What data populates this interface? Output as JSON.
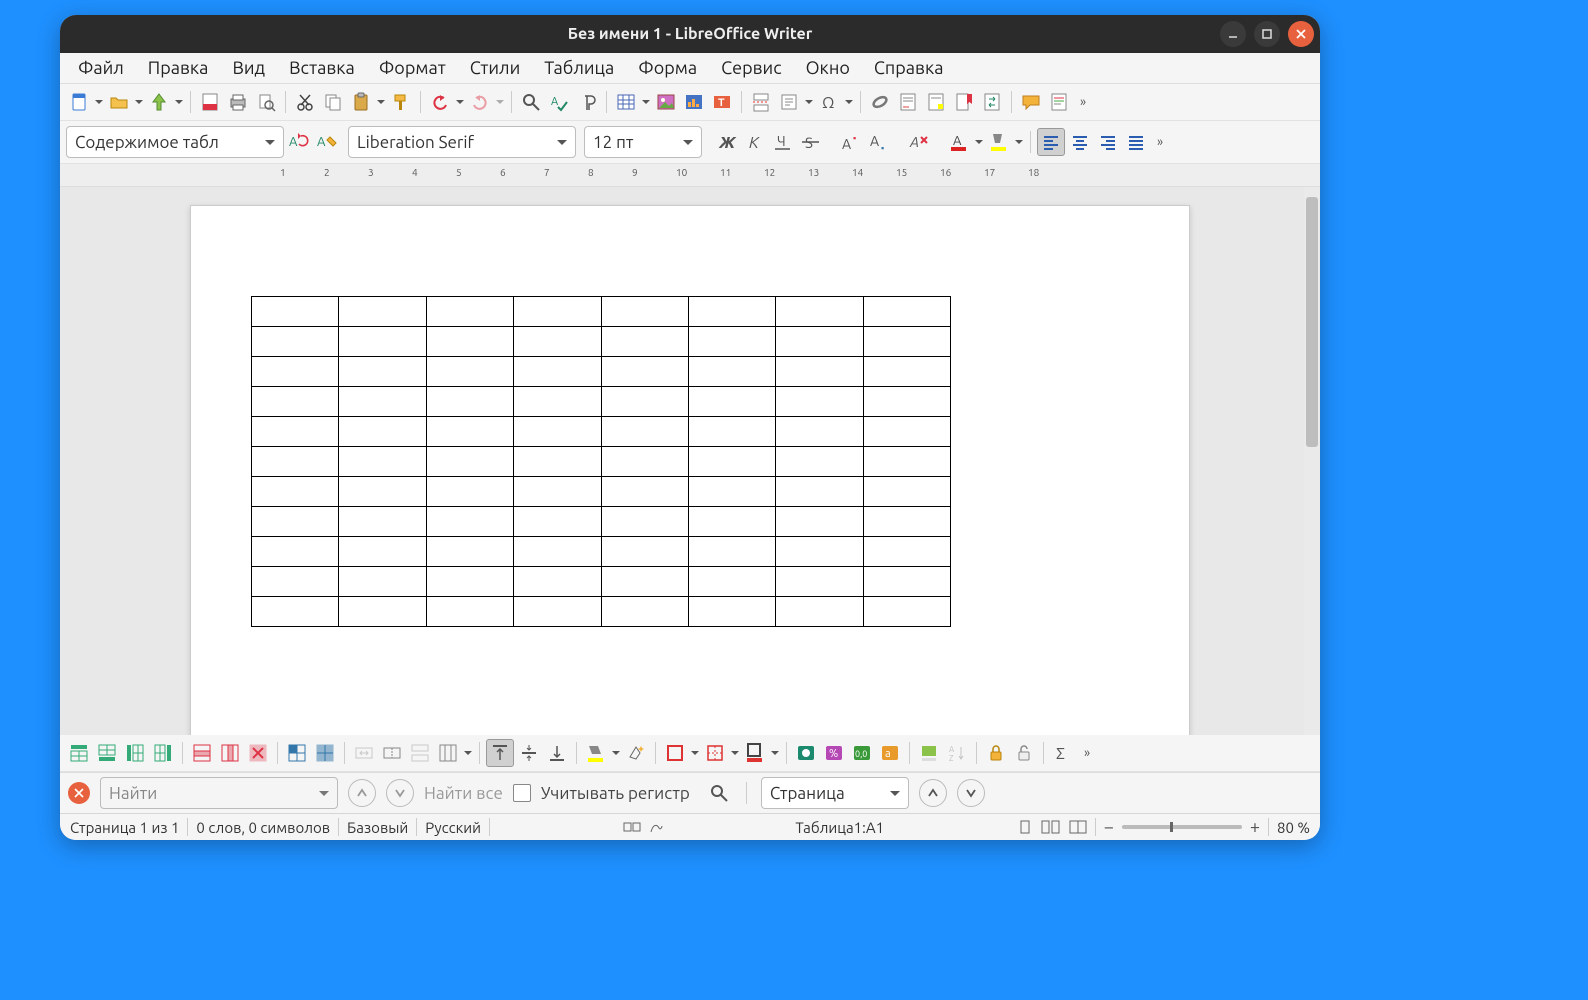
{
  "window": {
    "title": "Без имени 1 - LibreOffice Writer"
  },
  "menu": {
    "items": [
      "Файл",
      "Правка",
      "Вид",
      "Вставка",
      "Формат",
      "Стили",
      "Таблица",
      "Форма",
      "Сервис",
      "Окно",
      "Справка"
    ]
  },
  "format_bar": {
    "para_style": "Содержимое табл",
    "font_name": "Liberation Serif",
    "font_size": "12 пт"
  },
  "ruler": {
    "numbers": [
      1,
      2,
      3,
      4,
      5,
      6,
      7,
      8,
      9,
      10,
      11,
      12,
      13,
      14,
      15,
      16,
      17,
      18
    ]
  },
  "document": {
    "table": {
      "rows": 11,
      "cols": 8
    }
  },
  "findbar": {
    "placeholder": "Найти",
    "find_all": "Найти все",
    "match_case": "Учитывать регистр",
    "nav_combo": "Страница"
  },
  "status": {
    "page": "Страница 1 из 1",
    "words": "0 слов, 0 символов",
    "style": "Базовый",
    "lang": "Русский",
    "cell": "Таблица1:A1",
    "zoom": "80 %"
  }
}
